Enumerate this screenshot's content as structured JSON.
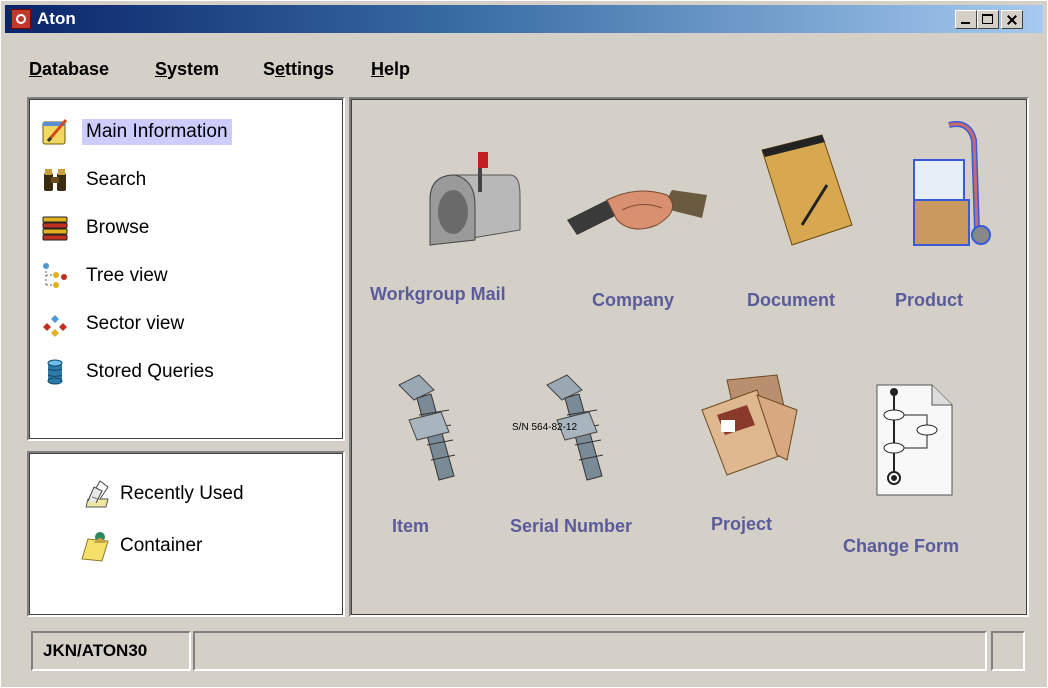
{
  "window": {
    "title": "Aton"
  },
  "menubar": {
    "items": [
      {
        "label": "Database",
        "underline": "D"
      },
      {
        "label": "System",
        "underline": "S"
      },
      {
        "label": "Settings",
        "underline": "e"
      },
      {
        "label": "Help",
        "underline": "H"
      }
    ]
  },
  "nav": {
    "items": [
      {
        "label": "Main Information",
        "icon": "notepad-pencil-icon",
        "selected": true
      },
      {
        "label": "Search",
        "icon": "binoculars-icon"
      },
      {
        "label": "Browse",
        "icon": "list-icon"
      },
      {
        "label": "Tree view",
        "icon": "tree-icon"
      },
      {
        "label": "Sector view",
        "icon": "sector-icon"
      },
      {
        "label": "Stored Queries",
        "icon": "database-icon"
      }
    ]
  },
  "quick": {
    "items": [
      {
        "label": "Recently Used",
        "icon": "papers-icon"
      },
      {
        "label": "Container",
        "icon": "folder-icon"
      }
    ]
  },
  "tiles": [
    {
      "label": "Workgroup Mail",
      "icon": "mailbox-icon"
    },
    {
      "label": "Company",
      "icon": "handshake-icon"
    },
    {
      "label": "Document",
      "icon": "notepad-icon"
    },
    {
      "label": "Product",
      "icon": "hand-truck-icon"
    },
    {
      "label": "Item",
      "icon": "bolt-icon"
    },
    {
      "label": "Serial Number",
      "icon": "bolt-serial-icon",
      "serial_text": "S/N 564-82-12"
    },
    {
      "label": "Project",
      "icon": "folders-icon"
    },
    {
      "label": "Change Form",
      "icon": "flowchart-doc-icon"
    }
  ],
  "statusbar": {
    "user": "JKN/ATON30"
  },
  "colors": {
    "tile_label": "#5b5b9a",
    "selection": "#ccccff",
    "titlebar_start": "#0a246a"
  }
}
